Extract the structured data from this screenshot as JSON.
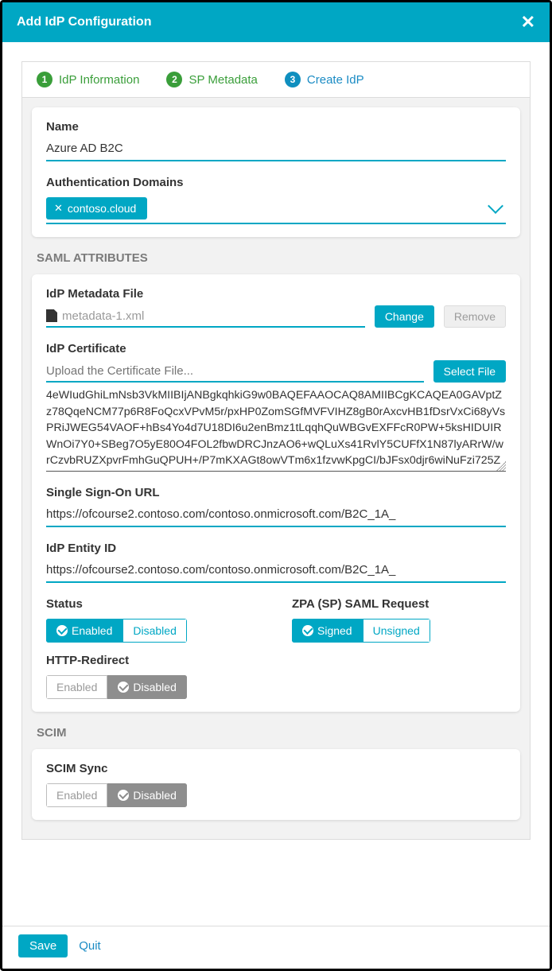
{
  "dialog": {
    "title": "Add IdP Configuration"
  },
  "steps": [
    {
      "num": "1",
      "label": "IdP Information",
      "state": "done"
    },
    {
      "num": "2",
      "label": "SP Metadata",
      "state": "done"
    },
    {
      "num": "3",
      "label": "Create IdP",
      "state": "active"
    }
  ],
  "basic": {
    "name_label": "Name",
    "name_value": "Azure AD B2C",
    "auth_domains_label": "Authentication Domains",
    "domain_chip": "contoso.cloud"
  },
  "saml": {
    "section_label": "SAML ATTRIBUTES",
    "metadata_label": "IdP Metadata File",
    "metadata_filename": "metadata-1.xml",
    "change_label": "Change",
    "remove_label": "Remove",
    "cert_label": "IdP Certificate",
    "cert_placeholder": "Upload the Certificate File...",
    "select_file_label": "Select File",
    "cert_text": "4eWIudGhiLmNsb3VkMIIBIjANBgkqhkiG9w0BAQEFAAOCAQ8AMIIBCgKCAQEA0GAVptZz78QqeNCM77p6R8FoQcxVPvM5r/pxHP0ZomSGfMVFVIHZ8gB0rAxcvHB1fDsrVxCi68yVsPRiJWEG54VAOF+hBs4Yo4d7U18DI6u2enBmz1tLqqhQuWBGvEXFFcR0PW+5ksHIDUIRWnOi7Y0+SBeg7O5yE80O4FOL2fbwDRCJnzAO6+wQLuXs41RvlY5CUFfX1N87lyARrW/wrCzvbRUZXpvrFmhGuQPUH+/P7mKXAGt8owVTm6x1fzvwKpgCI/bJFsx0djr6wiNuFzi725Z",
    "sso_url_label": "Single Sign-On URL",
    "sso_url_value": "https://ofcourse2.contoso.com/contoso.onmicrosoft.com/B2C_1A_",
    "entity_id_label": "IdP Entity ID",
    "entity_id_value": "https://ofcourse2.contoso.com/contoso.onmicrosoft.com/B2C_1A_",
    "status_label": "Status",
    "status_enabled": "Enabled",
    "status_disabled": "Disabled",
    "zpa_label": "ZPA (SP) SAML Request",
    "zpa_signed": "Signed",
    "zpa_unsigned": "Unsigned",
    "redirect_label": "HTTP-Redirect",
    "redirect_enabled": "Enabled",
    "redirect_disabled": "Disabled"
  },
  "scim": {
    "section_label": "SCIM",
    "sync_label": "SCIM Sync",
    "enabled": "Enabled",
    "disabled": "Disabled"
  },
  "footer": {
    "save": "Save",
    "quit": "Quit"
  }
}
